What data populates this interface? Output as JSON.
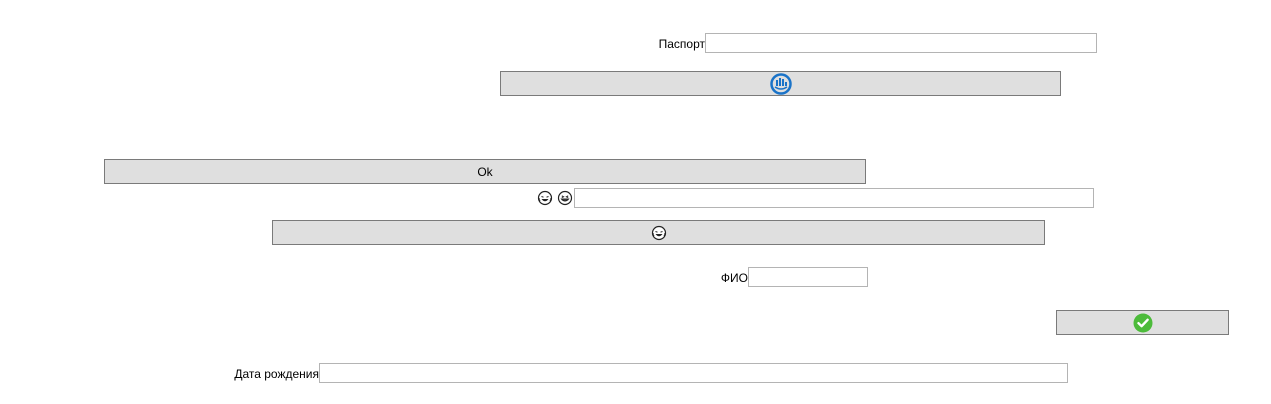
{
  "colors": {
    "button_bg": "#dfdfdf",
    "button_border": "#7a7a7a",
    "field_border": "#b4b4b4",
    "icon_blue": "#1a73c8",
    "icon_green": "#4cbb3a"
  },
  "form": {
    "passport_label": "Паспорт",
    "passport_value": "",
    "refresh_button_icon": "circular-refresh-icon",
    "ok_button_label": "Ok",
    "emoji_field_prefix_icons": [
      "laughing-tears-face-icon",
      "grinning-squint-face-icon"
    ],
    "emoji_field_value": "",
    "emoji_button_icon": "laughing-tears-face-icon",
    "fio_label": "ФИО",
    "fio_value": "",
    "confirm_button_icon": "green-check-circle-icon",
    "birthdate_label": "Дата рождения",
    "birthdate_value": ""
  }
}
